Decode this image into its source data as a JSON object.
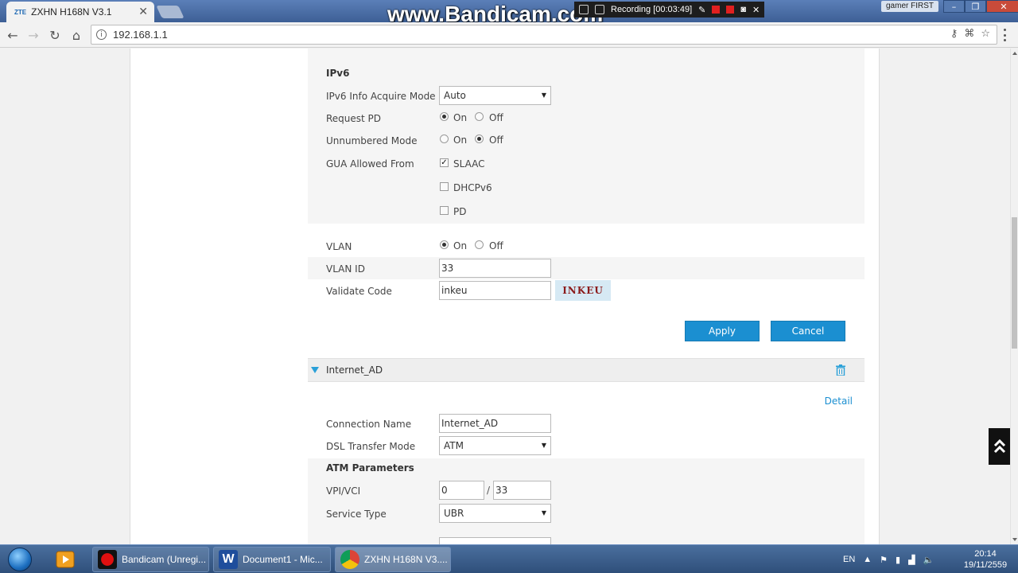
{
  "browser": {
    "tab_title": "ZXHN H168N V3.1",
    "tab_logo": "ZTE",
    "url": "192.168.1.1",
    "user_badge": "gamer FIRST",
    "icons": [
      "back-arrow-icon",
      "forward-arrow-icon",
      "reload-icon",
      "home-icon",
      "info-icon",
      "key-icon",
      "translate-icon",
      "star-icon",
      "menu-icon"
    ]
  },
  "overlay": {
    "watermark": "www.Bandicam.com",
    "recording": "Recording [00:03:49]"
  },
  "ipv6": {
    "heading": "IPv6",
    "acquire_mode_label": "IPv6 Info Acquire Mode",
    "acquire_mode_value": "Auto",
    "request_pd_label": "Request PD",
    "request_pd_value": "On",
    "unnumbered_label": "Unnumbered Mode",
    "unnumbered_value": "Off",
    "on_label": "On",
    "off_label": "Off",
    "gua_label": "GUA Allowed From",
    "gua_options": [
      {
        "label": "SLAAC",
        "checked": true
      },
      {
        "label": "DHCPv6",
        "checked": false
      },
      {
        "label": "PD",
        "checked": false
      }
    ]
  },
  "vlan": {
    "vlan_label": "VLAN",
    "vlan_value": "On",
    "vlan_id_label": "VLAN ID",
    "vlan_id_value": "33",
    "validate_label": "Validate Code",
    "validate_value": "inkeu",
    "captcha": "INKEU"
  },
  "actions": {
    "apply": "Apply",
    "cancel": "Cancel"
  },
  "internet_ad": {
    "title": "Internet_AD",
    "detail_link": "Detail",
    "conn_name_label": "Connection Name",
    "conn_name_value": "Internet_AD",
    "dsl_label": "DSL Transfer Mode",
    "dsl_value": "ATM",
    "atm_heading": "ATM Parameters",
    "vpivci_label": "VPI/VCI",
    "vpi_value": "0",
    "vci_value": "33",
    "slash": "/",
    "service_label": "Service Type",
    "service_value": "UBR"
  },
  "taskbar": {
    "tasks": [
      {
        "label": "Bandicam (Unregi...",
        "icon": "bandicam-icon"
      },
      {
        "label": "Document1 - Mic...",
        "icon": "word-icon"
      },
      {
        "label": "ZXHN H168N V3....",
        "icon": "chrome-icon"
      }
    ],
    "language": "EN",
    "time": "20:14",
    "date": "19/11/2559"
  },
  "colors": {
    "accent": "#1b8fd1",
    "captcha_bg": "#d6e9f4",
    "captcha_text": "#8b1a1a"
  }
}
